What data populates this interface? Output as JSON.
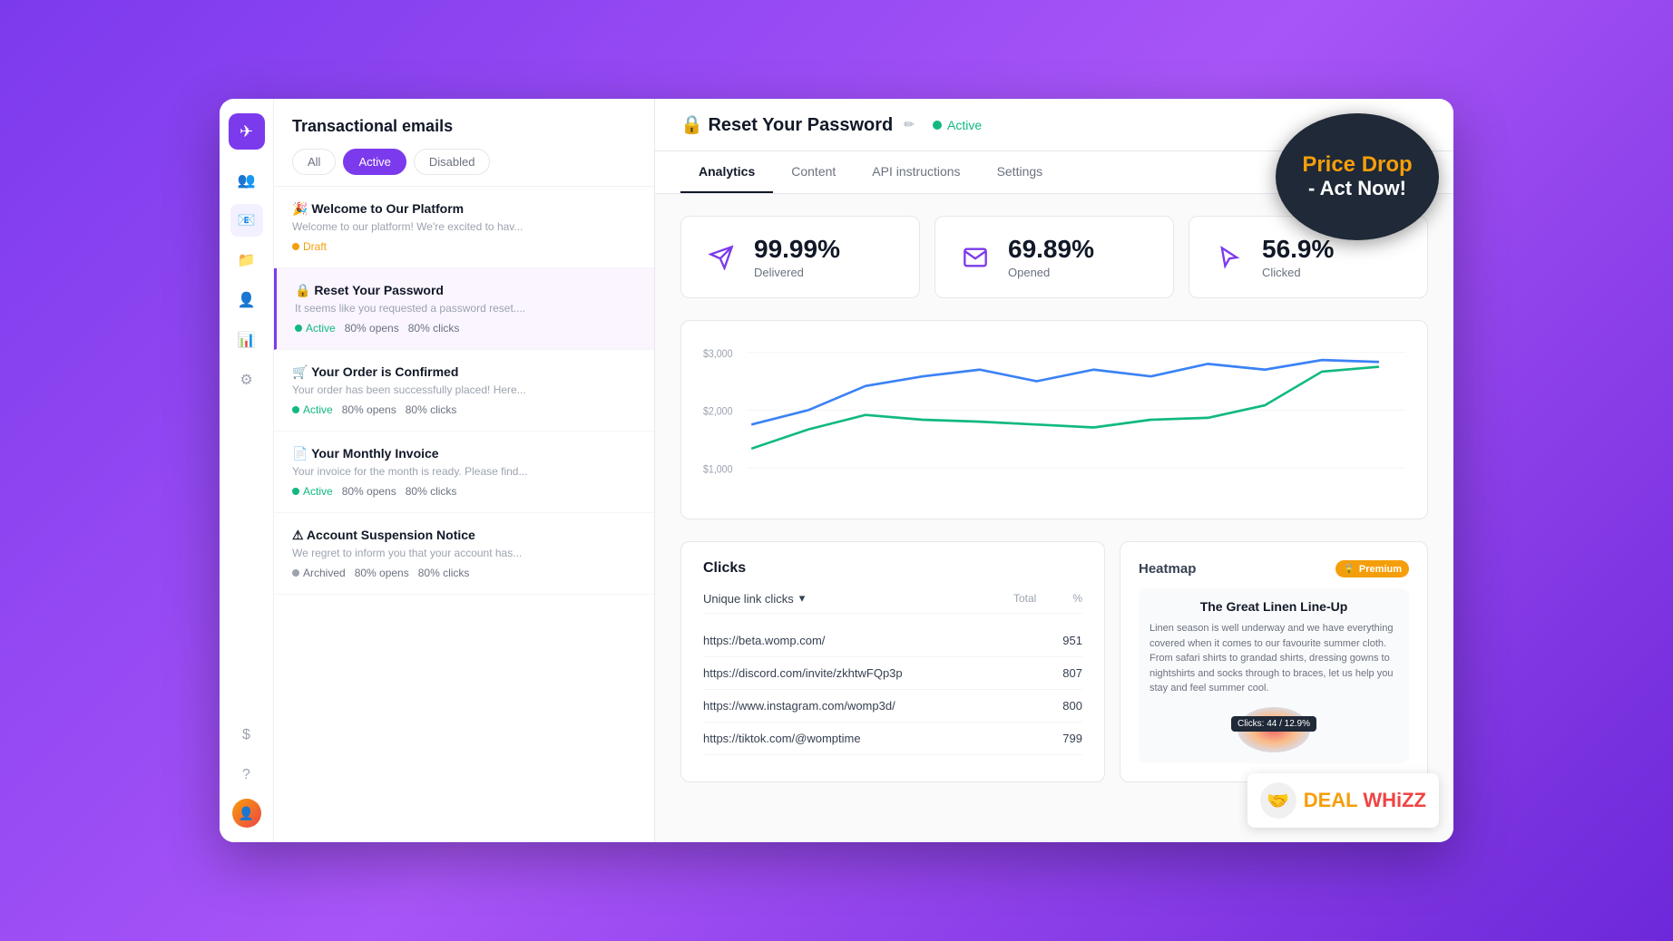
{
  "app": {
    "title": "Transactional emails",
    "logo_icon": "✈"
  },
  "sidebar": {
    "icons": [
      {
        "name": "teams-icon",
        "symbol": "👥",
        "active": false
      },
      {
        "name": "emails-icon",
        "symbol": "📧",
        "active": true
      },
      {
        "name": "folder-icon",
        "symbol": "📁",
        "active": false
      },
      {
        "name": "contacts-icon",
        "symbol": "👤",
        "active": false
      },
      {
        "name": "analytics-icon",
        "symbol": "📊",
        "active": false
      },
      {
        "name": "settings-icon",
        "symbol": "⚙",
        "active": false
      }
    ],
    "bottom_icons": [
      {
        "name": "billing-icon",
        "symbol": "$"
      },
      {
        "name": "help-icon",
        "symbol": "?"
      }
    ]
  },
  "email_list": {
    "title": "Transactional emails",
    "filters": [
      {
        "label": "All",
        "active": false
      },
      {
        "label": "Active",
        "active": true
      },
      {
        "label": "Disabled",
        "active": false
      }
    ],
    "items": [
      {
        "title": "🎉 Welcome to Our Platform",
        "preview": "Welcome to our platform! We're excited to hav...",
        "status": "draft",
        "status_label": "Draft",
        "opens": null,
        "clicks": null
      },
      {
        "title": "🔒 Reset Your Password",
        "preview": "It seems like you requested a password reset....",
        "status": "active",
        "status_label": "Active",
        "opens": "80% opens",
        "clicks": "80% clicks",
        "selected": true
      },
      {
        "title": "🛒 Your Order is Confirmed",
        "preview": "Your order has been successfully placed! Here...",
        "status": "active",
        "status_label": "Active",
        "opens": "80% opens",
        "clicks": "80% clicks"
      },
      {
        "title": "📄 Your Monthly Invoice",
        "preview": "Your invoice for the month is ready. Please find...",
        "status": "active",
        "status_label": "Active",
        "opens": "80% opens",
        "clicks": "80% clicks"
      },
      {
        "title": "⚠ Account Suspension Notice",
        "preview": "We regret to inform you that your account has...",
        "status": "archived",
        "status_label": "Archived",
        "opens": "80% opens",
        "clicks": "80% clicks"
      }
    ]
  },
  "main": {
    "header": {
      "email_subject": "🔒 Reset Your Password",
      "edit_label": "✏",
      "status": "Active"
    },
    "tabs": [
      {
        "label": "Analytics",
        "active": true
      },
      {
        "label": "Content",
        "active": false
      },
      {
        "label": "API instructions",
        "active": false
      },
      {
        "label": "Settings",
        "active": false
      }
    ],
    "stats": [
      {
        "icon": "send-icon",
        "icon_symbol": "➤",
        "value": "99.99%",
        "label": "Delivered"
      },
      {
        "icon": "open-icon",
        "icon_symbol": "✉",
        "value": "69.89%",
        "label": "Opened"
      },
      {
        "icon": "click-icon",
        "icon_symbol": "✦",
        "value": "56.9%",
        "label": "Clicked"
      }
    ],
    "chart": {
      "y_labels": [
        "$3,000",
        "$2,000",
        "$1,000"
      ],
      "blue_line": [
        120,
        180,
        260,
        290,
        310,
        280,
        310,
        290,
        330,
        320,
        350,
        380
      ],
      "green_line": [
        80,
        120,
        160,
        150,
        140,
        135,
        130,
        150,
        160,
        200,
        280,
        330
      ]
    },
    "clicks": {
      "title": "Clicks",
      "filter_label": "Unique link clicks",
      "col_total": "Total",
      "col_percent": "%",
      "links": [
        {
          "url": "https://beta.womp.com/",
          "total": "951",
          "percent": ""
        },
        {
          "url": "https://discord.com/invite/zkhtwFQp3p",
          "total": "807",
          "percent": ""
        },
        {
          "url": "https://www.instagram.com/womp3d/",
          "total": "800",
          "percent": ""
        },
        {
          "url": "https://tiktok.com/@womptime",
          "total": "799",
          "percent": ""
        }
      ]
    },
    "heatmap": {
      "title": "Heatmap",
      "premium_label": "Premium",
      "email_title": "The Great Linen Line-Up",
      "email_body": "Linen season is well underway and we have everything covered when it comes to our favourite summer cloth. From safari shirts to grandad shirts, dressing gowns to nightshirts and socks through to braces, let us help you stay and feel summer cool.",
      "tooltip": "Clicks: 44 / 12.9%"
    }
  },
  "ads": {
    "price_drop": {
      "line1": "Price Drop",
      "line2": "- Act Now!"
    },
    "dealwhizz": {
      "deal": "DEAL",
      "whizz": "WHiZZ"
    }
  }
}
